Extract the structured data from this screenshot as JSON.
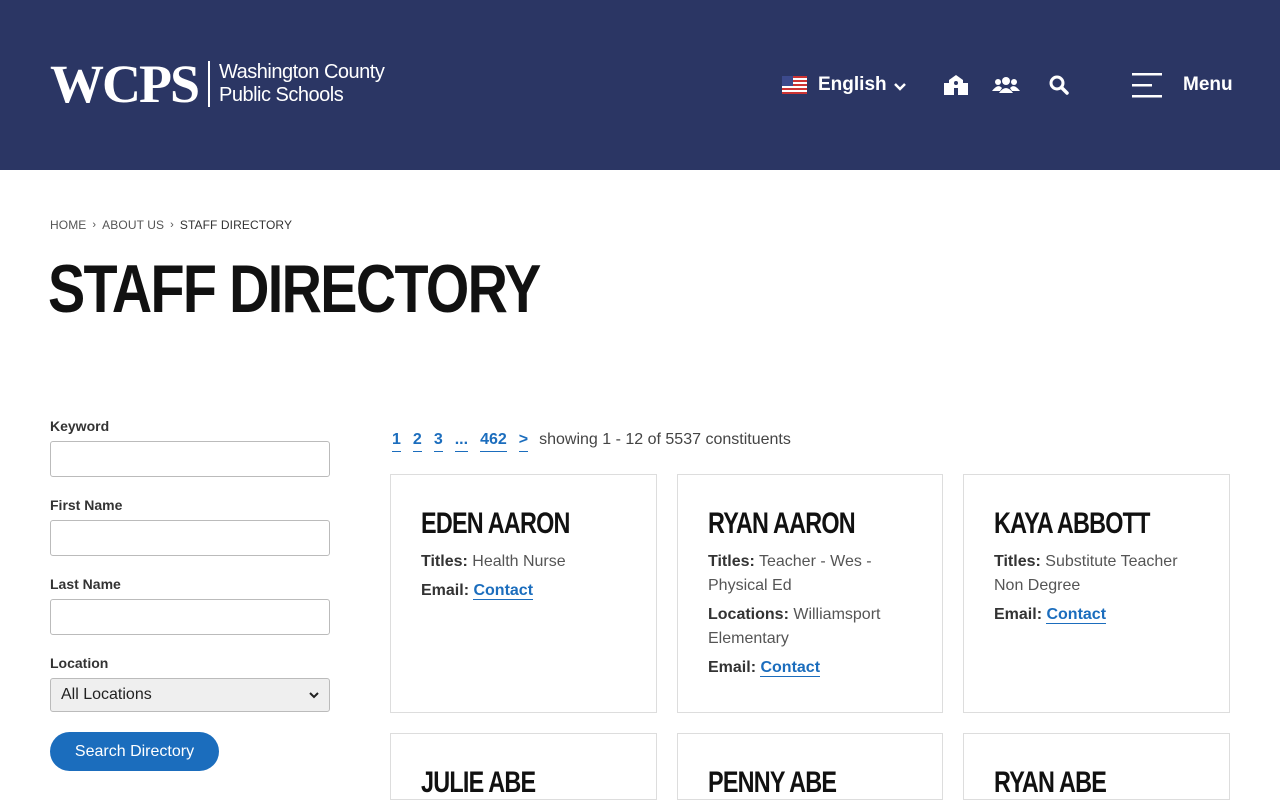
{
  "header": {
    "logo_mark": "WCPS",
    "logo_line1": "Washington County",
    "logo_line2": "Public Schools",
    "language": "English",
    "menu_label": "Menu",
    "bg_color": "#2b3664"
  },
  "breadcrumb": {
    "home": "HOME",
    "about": "ABOUT US",
    "current": "STAFF DIRECTORY"
  },
  "page_title": "STAFF DIRECTORY",
  "filters": {
    "keyword_label": "Keyword",
    "first_name_label": "First Name",
    "last_name_label": "Last Name",
    "location_label": "Location",
    "location_value": "All Locations",
    "search_button": "Search Directory"
  },
  "pager": {
    "pages": [
      "1",
      "2",
      "3",
      "...",
      "462"
    ],
    "next": ">",
    "count_text": "showing 1 - 12 of 5537 constituents"
  },
  "cards": [
    {
      "name": "EDEN AARON",
      "titles_label": "Titles:",
      "titles": "Health Nurse",
      "email_label": "Email:",
      "email_link": "Contact"
    },
    {
      "name": "RYAN AARON",
      "titles_label": "Titles:",
      "titles": "Teacher - Wes - Physical Ed",
      "locations_label": "Locations:",
      "locations": "Williamsport Elementary",
      "email_label": "Email:",
      "email_link": "Contact"
    },
    {
      "name": "KAYA ABBOTT",
      "titles_label": "Titles:",
      "titles": "Substitute Teacher Non Degree",
      "email_label": "Email:",
      "email_link": "Contact"
    },
    {
      "name": "JULIE ABE"
    },
    {
      "name": "PENNY ABE"
    },
    {
      "name": "RYAN ABE"
    }
  ],
  "colors": {
    "accent": "#1b6dbd",
    "header": "#2b3664"
  }
}
